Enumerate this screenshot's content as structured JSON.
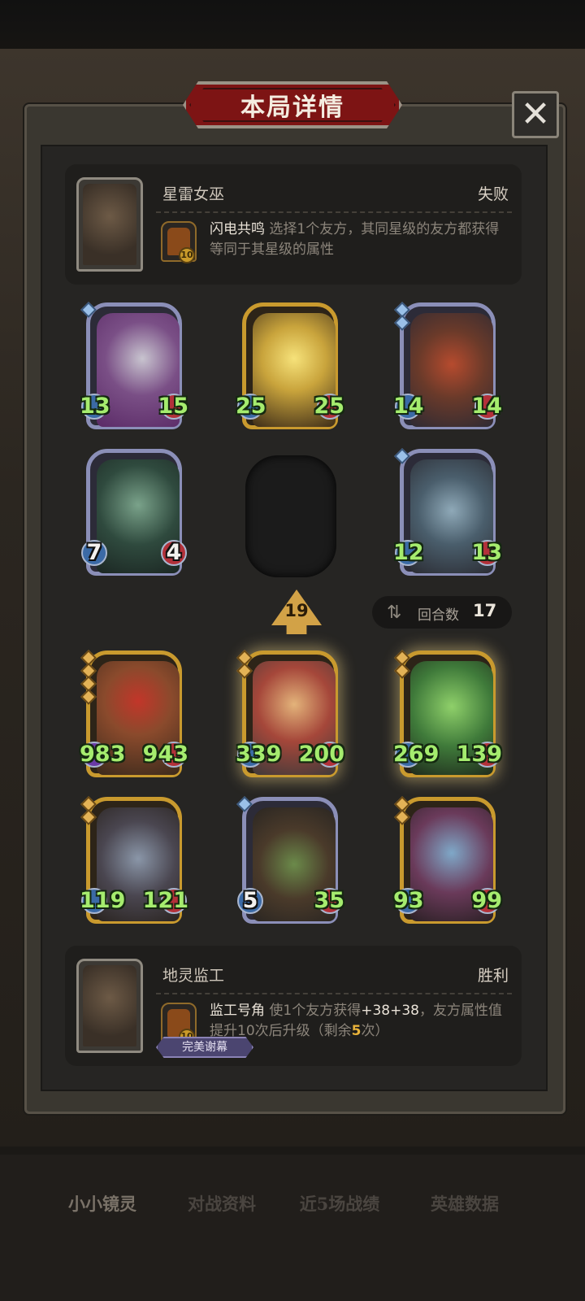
{
  "title": "本局详情",
  "close_label": "✕",
  "opponent": {
    "name": "星雷女巫",
    "result": "失败",
    "skill": {
      "name": "闪电共鸣",
      "description": "选择1个友方，其同星级的友方都获得等同于其星级的属性",
      "level": "10"
    }
  },
  "opponent_units": [
    {
      "atk": "13",
      "hp": "15"
    },
    {
      "atk": "25",
      "hp": "25"
    },
    {
      "atk": "14",
      "hp": "14"
    },
    {
      "atk": "7",
      "hp": "4"
    },
    {
      "atk": "12",
      "hp": "13"
    }
  ],
  "tier_arrow": "19",
  "rounds": {
    "label": "回合数",
    "value": "17"
  },
  "player_units": [
    {
      "atk": "983",
      "hp": "943"
    },
    {
      "atk": "339",
      "hp": "200"
    },
    {
      "atk": "269",
      "hp": "139"
    },
    {
      "atk": "119",
      "hp": "121"
    },
    {
      "atk": "5",
      "hp": "35"
    },
    {
      "atk": "93",
      "hp": "99"
    }
  ],
  "player": {
    "name": "地灵监工",
    "result": "胜利",
    "skill": {
      "name": "监工号角",
      "desc_a": "使1个友方获得",
      "buff": "+38+38",
      "desc_b": "，友方属性值提升10次后升级（剩余",
      "remaining": "5",
      "desc_c": "次）",
      "level": "10"
    },
    "badge": "完美谢幕"
  },
  "bottom_tabs": [
    "小小镜灵",
    "对战资料",
    "近5场战绩",
    "英雄数据"
  ]
}
